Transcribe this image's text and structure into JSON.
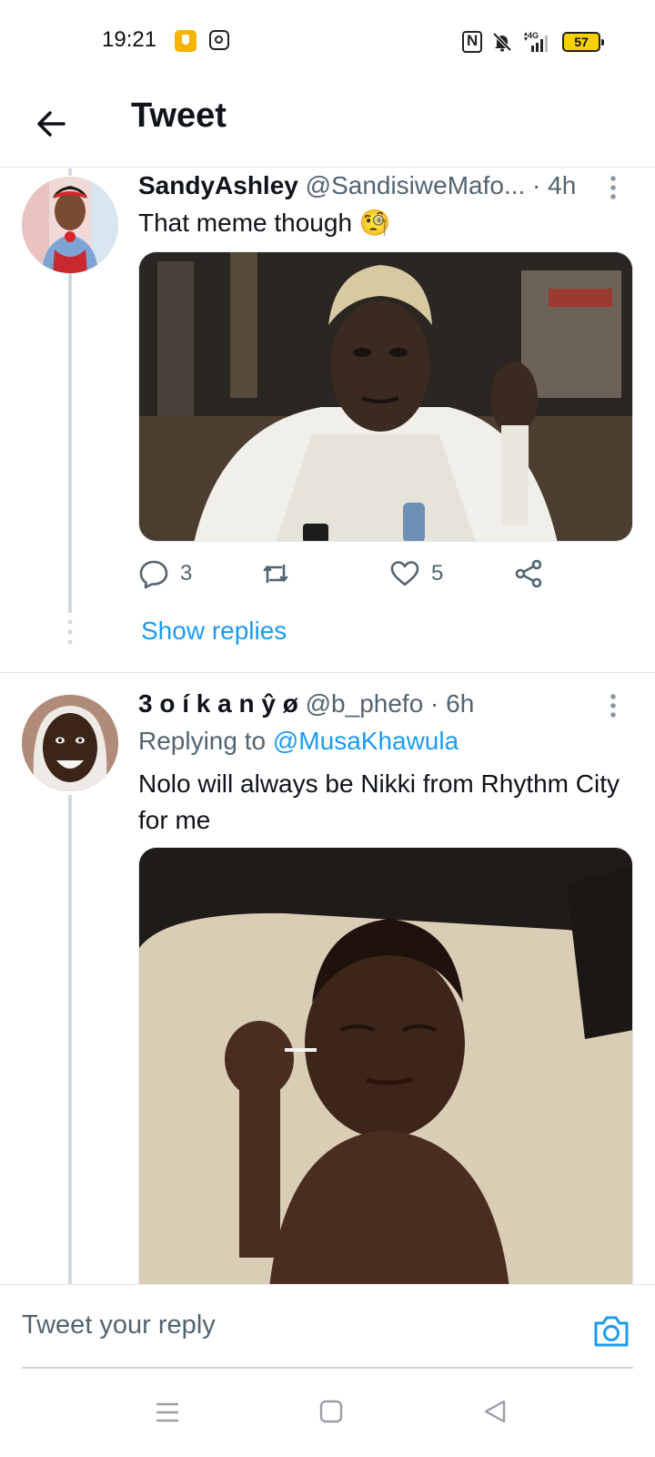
{
  "status_bar": {
    "time": "19:21",
    "battery": "57",
    "icons": [
      "notification-app-icon",
      "instagram-icon",
      "nfc-icon",
      "bell-off-icon",
      "signal-4g-icon",
      "battery-icon"
    ]
  },
  "header": {
    "title": "Tweet",
    "back_icon": "arrow-left-icon"
  },
  "tweets": [
    {
      "display_name": "SandyAshley",
      "handle": "@SandisiweMafo...",
      "time": " · 4h",
      "text": "That meme though 🧐",
      "media_description": "",
      "actions": {
        "replies": "3",
        "retweets": "",
        "likes": "5"
      }
    },
    {
      "display_name": "3 o í k a n ŷ ø",
      "handle": " @b_phefo",
      "time": " · 6h",
      "replying_prefix": "Replying to ",
      "replying_mention": "@MusaKhawula",
      "text": "Nolo will always be Nikki from Rhythm City for me"
    }
  ],
  "show_replies": "Show replies",
  "composer": {
    "placeholder": "Tweet your reply"
  },
  "colors": {
    "accent": "#1d9bf0",
    "text_primary": "#0f1419",
    "text_secondary": "#536471",
    "thread_line": "#cfd9de"
  }
}
